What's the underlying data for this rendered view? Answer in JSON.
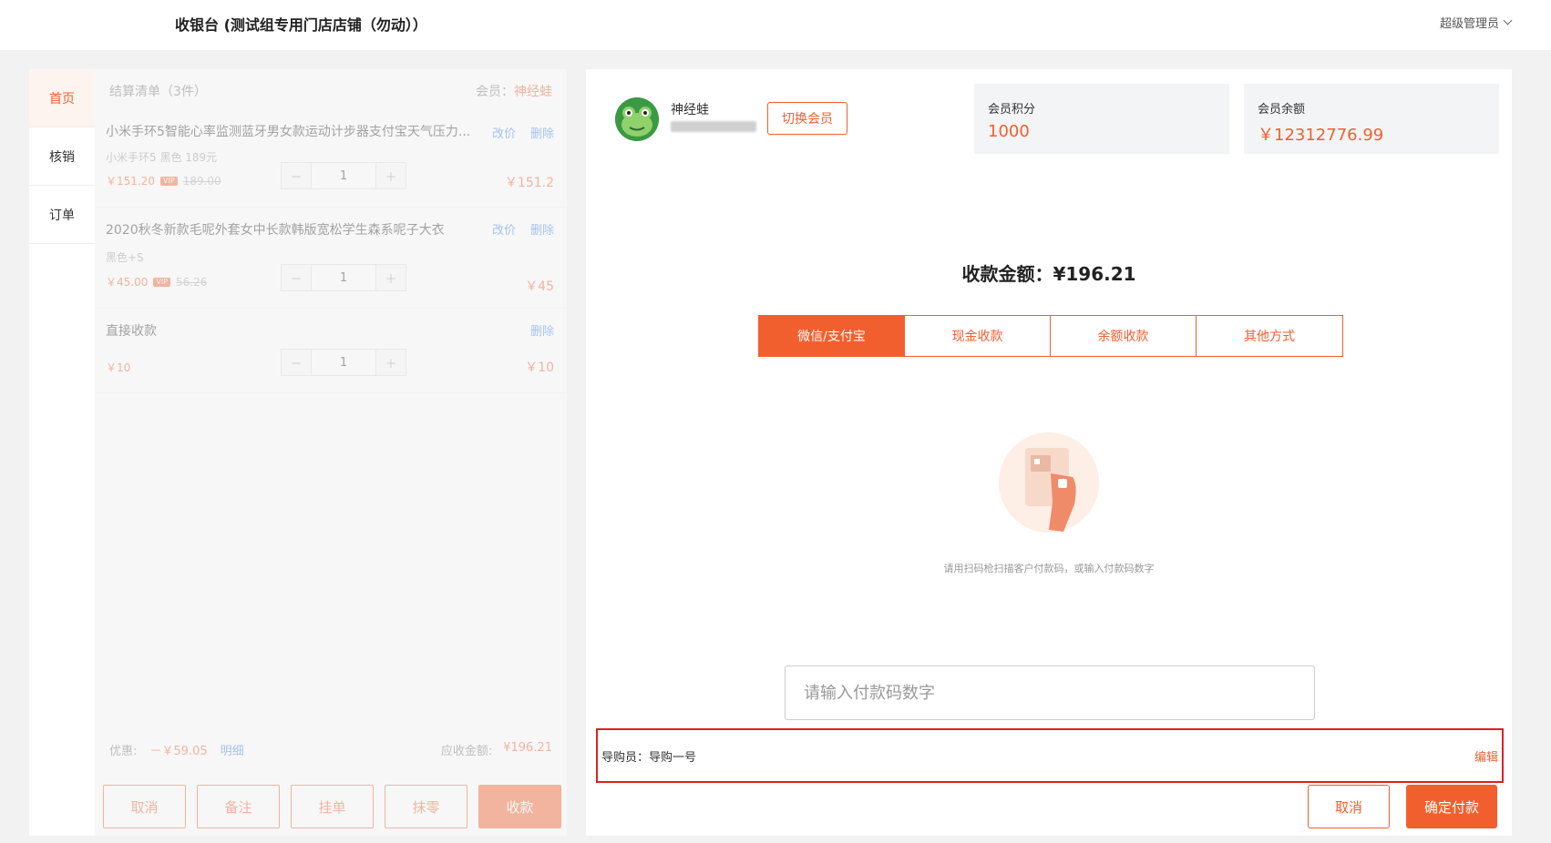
{
  "header": {
    "title": "收银台 (测试组专用门店店铺（勿动））",
    "user": "超级管理员"
  },
  "nav": [
    "首页",
    "核销",
    "订单"
  ],
  "left": {
    "title": "结算清单（3件）",
    "member_label": "会员：",
    "member_name": "神经蛙",
    "items": [
      {
        "name": "小米手环5智能心率监测蓝牙男女款运动计步器支付宝天气压力...",
        "edit_label": "改价",
        "delete_label": "删除",
        "sku": "小米手环5 黑色 189元",
        "price": "￥151.20",
        "vip": "VIP",
        "original": "189.00",
        "qty": "1",
        "total": "￥151.2"
      },
      {
        "name": "2020秋冬新款毛呢外套女中长款韩版宽松学生森系呢子大衣",
        "edit_label": "改价",
        "delete_label": "删除",
        "sku": "黑色+S",
        "price": "￥45.00",
        "vip": "VIP",
        "original": "56.26",
        "qty": "1",
        "total": "￥45"
      },
      {
        "name": "直接收款",
        "delete_label": "删除",
        "price": "￥10",
        "qty": "1",
        "total": "￥10"
      }
    ],
    "discount_label": "优惠:",
    "discount_value": "－￥59.05",
    "detail_label": "明细",
    "due_label": "应收金额:",
    "due_value": "¥196.21",
    "buttons": {
      "cancel": "取消",
      "note": "备注",
      "hold": "挂单",
      "round": "抹零",
      "checkout": "收款"
    }
  },
  "member": {
    "name": "神经蛙",
    "switch_label": "切换会员",
    "points_label": "会员积分",
    "points_value": "1000",
    "balance_label": "会员余额",
    "balance_value": "￥12312776.99"
  },
  "payment": {
    "amount_text": "收款金额：¥196.21",
    "tabs": [
      "微信/支付宝",
      "现金收款",
      "余额收款",
      "其他方式"
    ],
    "hint": "请用扫码枪扫描客户付款码，或输入付款码数字",
    "input_placeholder": "请输入付款码数字",
    "guide_label": "导购员：导购一号",
    "guide_edit": "编辑",
    "cancel": "取消",
    "confirm": "确定付款"
  },
  "colors": {
    "accent": "#f25f2e",
    "link": "#3b82f6",
    "highlight_border": "#e02020"
  }
}
